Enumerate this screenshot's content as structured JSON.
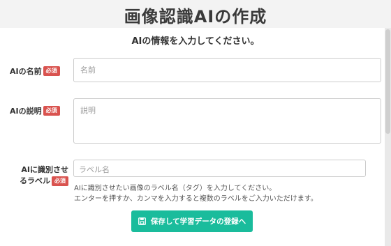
{
  "header": {
    "title": "画像認識AIの作成"
  },
  "form": {
    "subtitle": "AIの情報を入力してください。",
    "required_badge": "必須",
    "name": {
      "label": "AIの名前",
      "placeholder": "名前"
    },
    "description": {
      "label": "AIの説明",
      "placeholder": "説明"
    },
    "labels": {
      "label_line1": "AIに識別させ",
      "label_line2": "るラベル",
      "placeholder": "ラベル名",
      "help_line1": "AIに識別させたい画像のラベル名（タグ）を入力してください。",
      "help_line2": "エンターを押すか、カンマを入力すると複数のラベルをご入力いただけます。"
    },
    "submit_label": "保存して学習データの登録へ"
  },
  "icons": {
    "submit": "floppy-disk-icon"
  },
  "colors": {
    "accent": "#1abc9c",
    "badge": "#d9534f",
    "background": "#f3f3f3"
  }
}
